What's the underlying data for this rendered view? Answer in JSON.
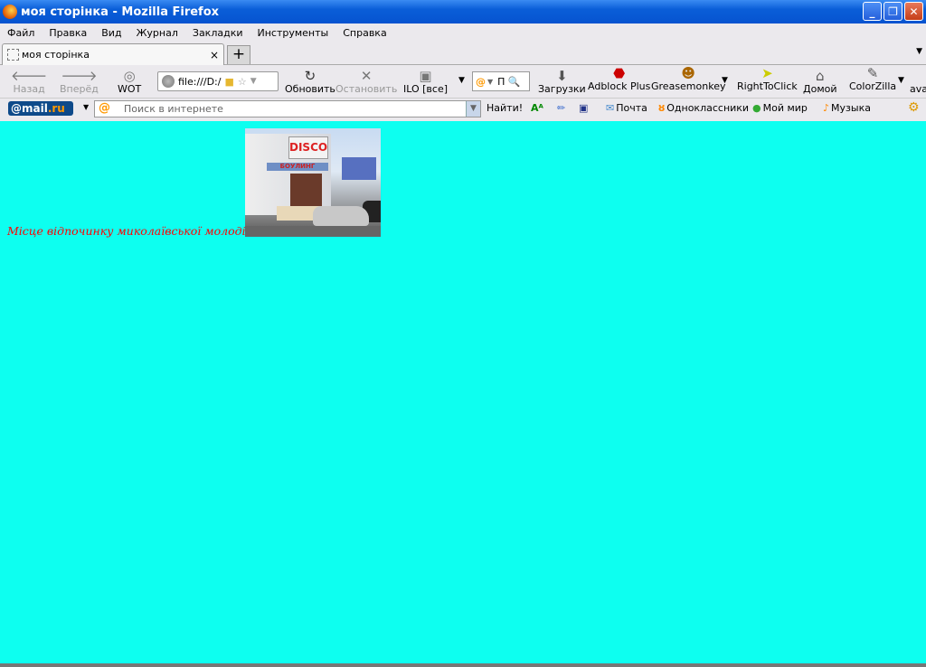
{
  "window": {
    "title": "моя сторінка - Mozilla Firefox"
  },
  "menu": [
    "Файл",
    "Правка",
    "Вид",
    "Журнал",
    "Закладки",
    "Инструменты",
    "Справка"
  ],
  "tab": {
    "title": "моя сторінка",
    "close": "×",
    "new_tab": "+"
  },
  "nav": {
    "back": "Назад",
    "forward": "Вперёд",
    "wot": "WOT",
    "url": "file:///D:/",
    "reload": "Обновить",
    "stop": "Остановить",
    "ilo": "ILO [все]",
    "search_text": "П",
    "downloads": "Загрузки",
    "adblock": "Adblock Plus",
    "greasemonkey": "Greasemonkey",
    "righttoclick": "RightToClick",
    "home": "Домой",
    "colorzilla": "ColorZilla",
    "more": "ava"
  },
  "mailbar": {
    "logo_at": "@mail",
    "logo_ru": ".ru",
    "search_placeholder": "Поиск в интернете",
    "find": "Найти!",
    "mail": "Почта",
    "ok": "Одноклассники",
    "moimir": "Мой мир",
    "music": "Музыка"
  },
  "page": {
    "caption": "Місце відпочинку миколаївської молоді",
    "photo_sign": "DISCO",
    "photo_band": "БОУЛИНГ"
  }
}
